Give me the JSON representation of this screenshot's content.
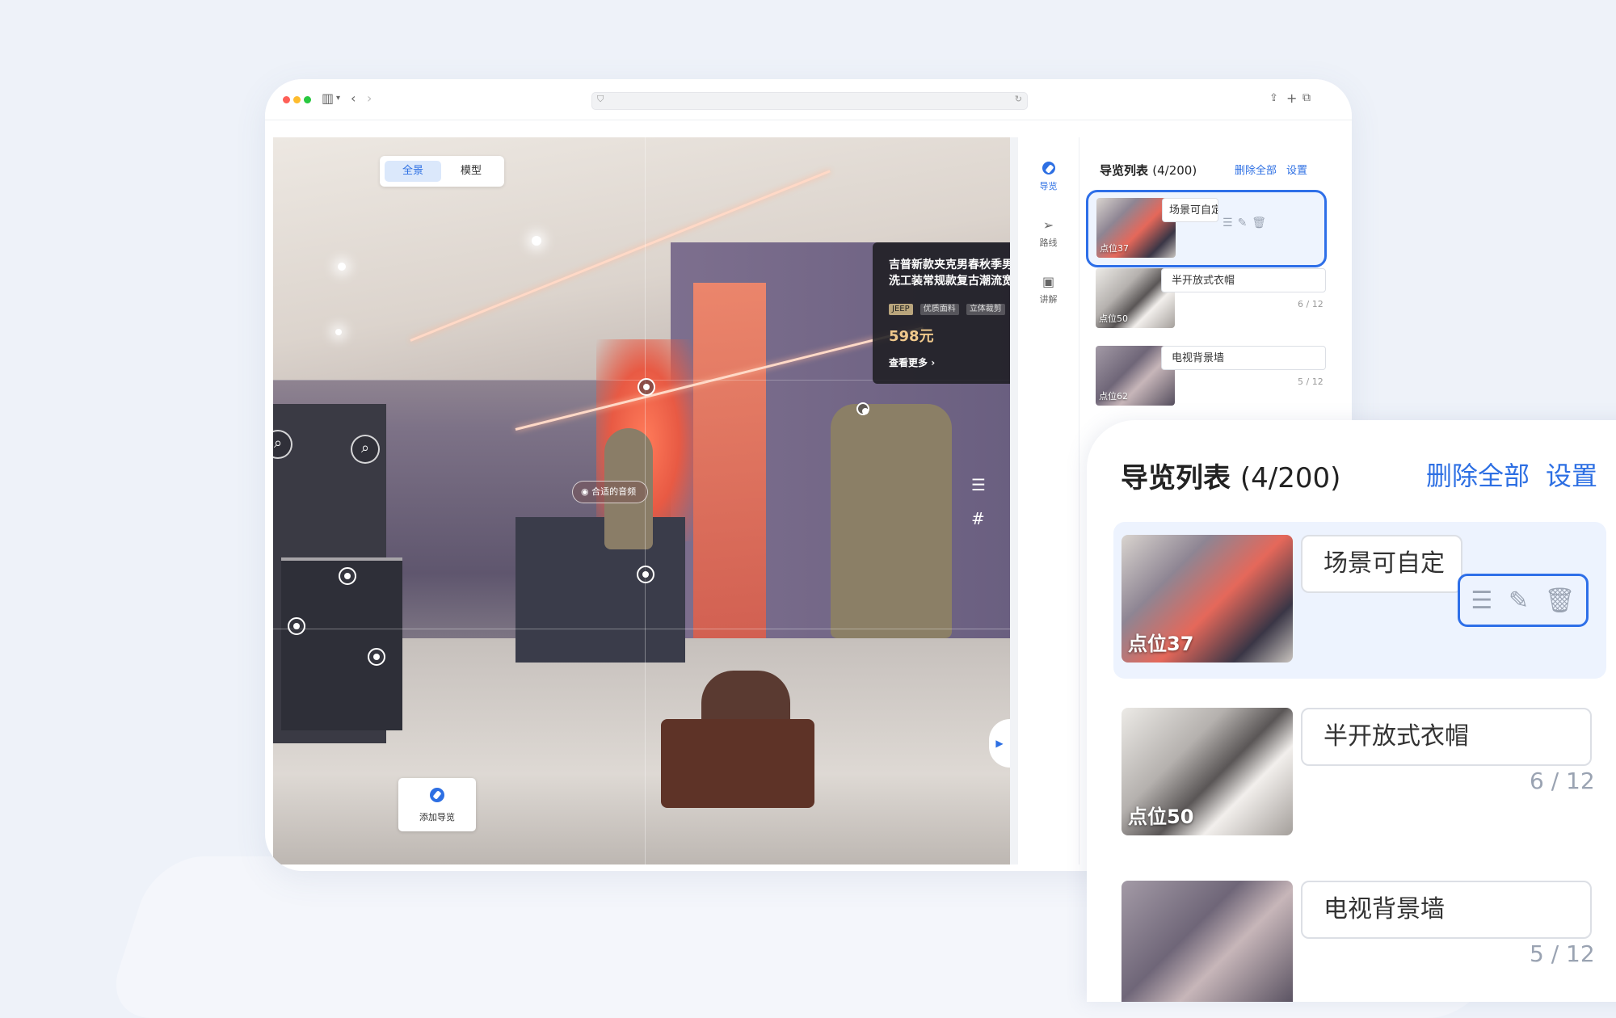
{
  "view_switch": {
    "panorama": "全景",
    "model": "模型"
  },
  "product": {
    "title_line1": "吉普新款夹克男春秋季男士",
    "title_line2": "洗工装常规款复古潮流宽松",
    "tags": [
      "JEEP",
      "优质面料",
      "立体裁剪"
    ],
    "price": "598元",
    "more": "查看更多"
  },
  "audio_tag": "合适的音频",
  "add_guide": "添加导览",
  "sidenav": [
    {
      "label": "导览",
      "icon": "compass-icon",
      "active": true
    },
    {
      "label": "路线",
      "icon": "send-icon",
      "active": false
    },
    {
      "label": "讲解",
      "icon": "video-icon",
      "active": false
    }
  ],
  "panel": {
    "title": "导览列表",
    "count": "(4/200)",
    "delete_all": "删除全部",
    "settings": "设置",
    "items": [
      {
        "point": "点位37",
        "name": "场景可自定",
        "count": ""
      },
      {
        "point": "点位50",
        "name": "半开放式衣帽",
        "count": "6 / 12"
      },
      {
        "point": "点位62",
        "name": "电视背景墙",
        "count": "5 / 12"
      }
    ]
  },
  "zoom_panel": {
    "title": "导览列表",
    "count": "(4/200)",
    "delete_all": "删除全部",
    "settings": "设置",
    "items": [
      {
        "point": "点位37",
        "name": "场景可自定",
        "count": ""
      },
      {
        "point": "点位50",
        "name": "半开放式衣帽",
        "count": "6 / 12"
      },
      {
        "point": "",
        "name": "电视背景墙",
        "count": "5 / 12"
      }
    ]
  },
  "colors": {
    "accent": "#2d6fe3",
    "selected_border": "#2e6fe8",
    "page_bg": "#eef2f9"
  }
}
